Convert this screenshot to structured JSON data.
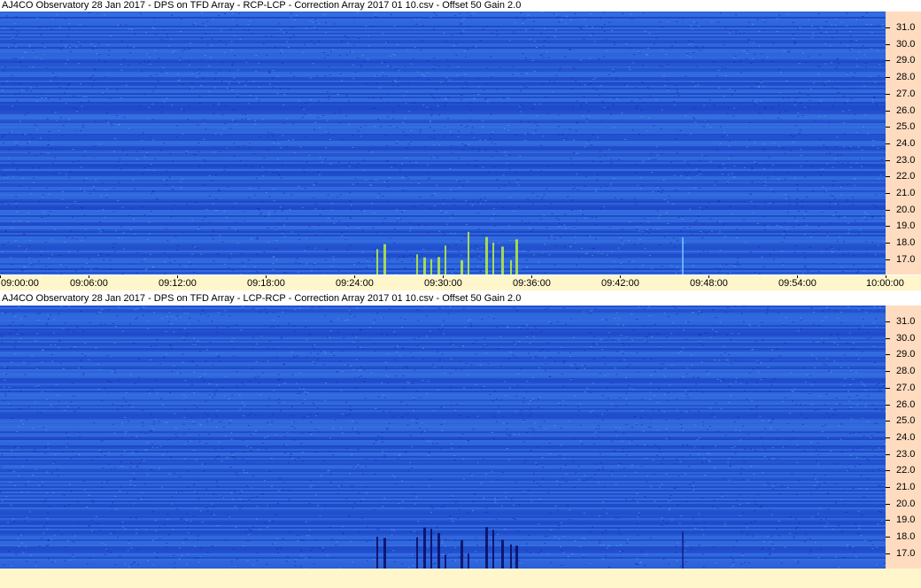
{
  "top_panel": {
    "title": "AJ4CO Observatory 28 Jan 2017  -  DPS on TFD Array  -  RCP-LCP  -  Correction Array 2017 01 10.csv  -  Offset 50  Gain 2.0",
    "y_ticks": [
      "31.0",
      "30.0",
      "29.0",
      "28.0",
      "27.0",
      "26.0",
      "25.0",
      "24.0",
      "23.0",
      "22.0",
      "21.0",
      "20.0",
      "19.0",
      "18.0",
      "17.0"
    ]
  },
  "bottom_panel": {
    "title": "AJ4CO Observatory 28 Jan 2017  -  DPS on TFD Array  -  LCP-RCP  -  Correction Array 2017 01 10.csv  -  Offset 50  Gain 2.0",
    "y_ticks": [
      "31.0",
      "30.0",
      "29.0",
      "28.0",
      "27.0",
      "26.0",
      "25.0",
      "24.0",
      "23.0",
      "22.0",
      "21.0",
      "20.0",
      "19.0",
      "18.0",
      "17.0"
    ]
  },
  "x_ticks": [
    "09:00:00",
    "09:06:00",
    "09:12:00",
    "09:18:00",
    "09:24:00",
    "09:30:00",
    "09:36:00",
    "09:42:00",
    "09:48:00",
    "09:54:00",
    "10:00:00"
  ],
  "colors": {
    "spectrogram_base": "#2a5fd8",
    "spectrogram_dark": "#1230b8",
    "burst_bright": "#b8f040",
    "burst_dark": "#0a0a60",
    "axis_panel": "#ffdcc0",
    "time_axis": "#fff6cc"
  }
}
